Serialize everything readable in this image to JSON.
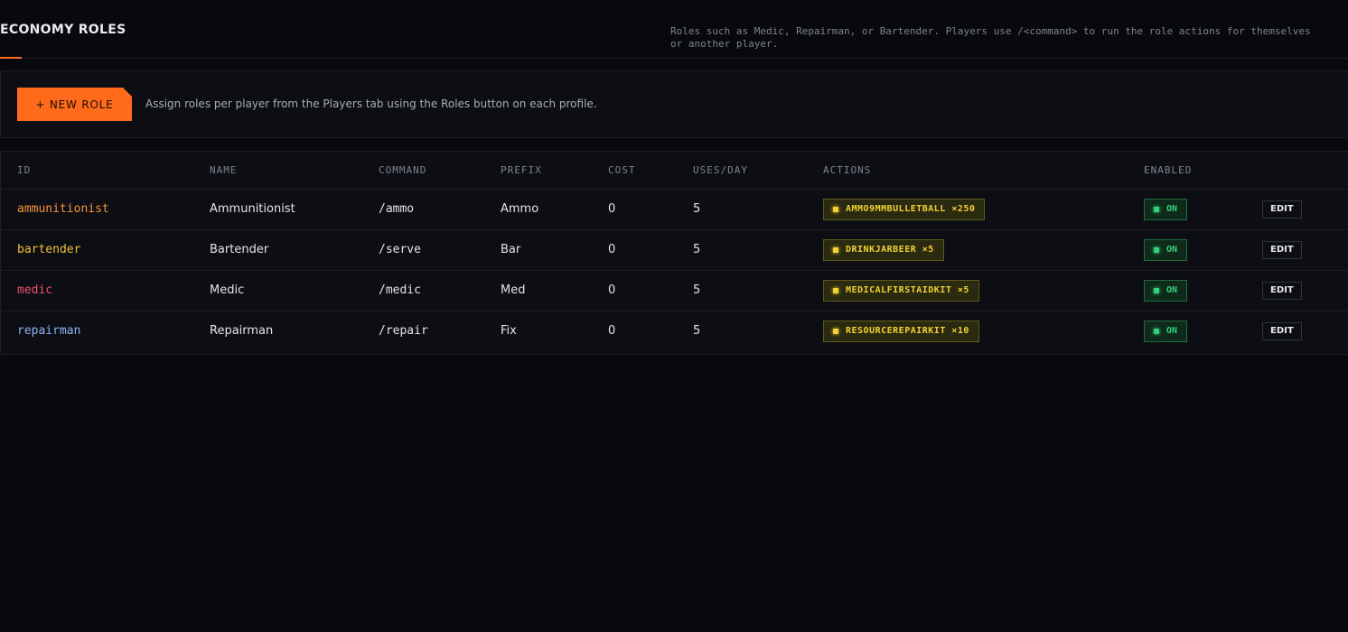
{
  "header": {
    "title": "ECONOMY ROLES",
    "description": "Roles such as Medic, Repairman, or Bartender. Players use /<command> to run the role actions for themselves or another player."
  },
  "toolbar": {
    "new_role_label": "+ NEW ROLE",
    "hint": "Assign roles per player from the Players tab using the Roles button on each profile."
  },
  "table": {
    "columns": [
      "ID",
      "NAME",
      "COMMAND",
      "PREFIX",
      "COST",
      "USES/DAY",
      "ACTIONS",
      "ENABLED"
    ],
    "rows": [
      {
        "id": "ammunitionist",
        "name": "Ammunitionist",
        "command": "/ammo",
        "prefix": "Ammo",
        "cost": "0",
        "uses": "5",
        "action": "AMMO9MMBULLETBALL ×250",
        "enabled": "ON",
        "edit": "EDIT",
        "id_color": "#f7933a"
      },
      {
        "id": "bartender",
        "name": "Bartender",
        "command": "/serve",
        "prefix": "Bar",
        "cost": "0",
        "uses": "5",
        "action": "DRINKJARBEER ×5",
        "enabled": "ON",
        "edit": "EDIT",
        "id_color": "#f1c232"
      },
      {
        "id": "medic",
        "name": "Medic",
        "command": "/medic",
        "prefix": "Med",
        "cost": "0",
        "uses": "5",
        "action": "MEDICALFIRSTAIDKIT ×5",
        "enabled": "ON",
        "edit": "EDIT",
        "id_color": "#f0506e"
      },
      {
        "id": "repairman",
        "name": "Repairman",
        "command": "/repair",
        "prefix": "Fix",
        "cost": "0",
        "uses": "5",
        "action": "RESOURCEREPAIRKIT ×10",
        "enabled": "ON",
        "edit": "EDIT",
        "id_color": "#8fb3f5"
      }
    ]
  },
  "colors": {
    "accent": "#ff6b1a",
    "chip_text": "#f1d133",
    "enabled_text": "#34d17b"
  }
}
